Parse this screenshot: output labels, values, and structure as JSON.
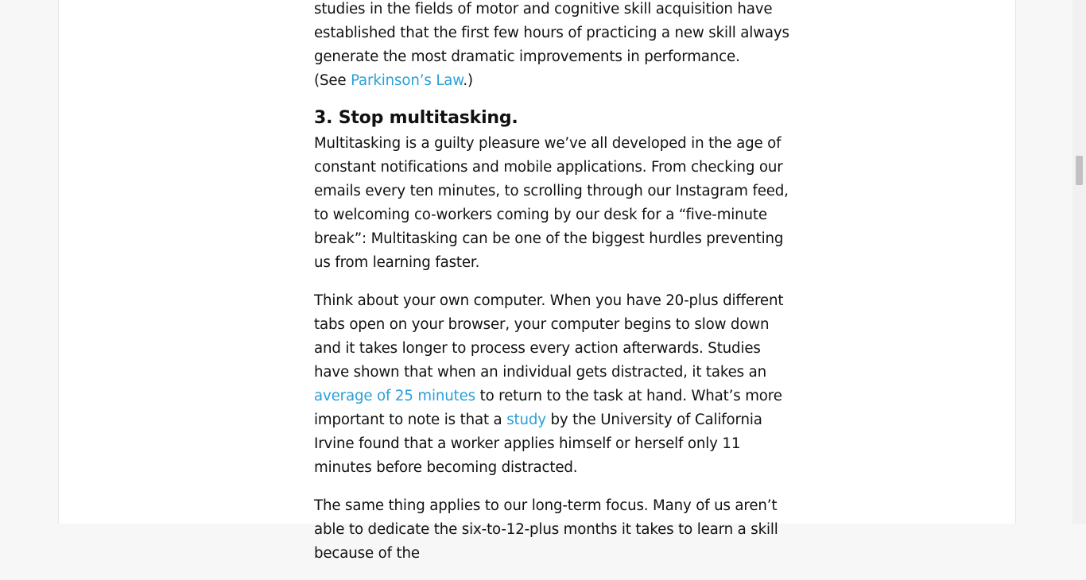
{
  "article": {
    "intro": {
      "text": "studies in the fields of motor and cognitive skill acquisition have established that the first few hours of practicing a new skill always generate the most dramatic improvements in performance.",
      "see_prefix": "(See ",
      "see_link": "Parkinson’s Law",
      "see_suffix": ".)"
    },
    "section_heading": "3. Stop multitasking.",
    "para1": "Multitasking is a guilty pleasure we’ve all developed in the age of constant notifications and mobile applications. From checking our emails every ten minutes, to scrolling through our Instagram feed, to welcoming co-workers coming by our desk for a “five-minute break”: Multitasking can be one of the biggest hurdles preventing us from learning faster.",
    "para2": {
      "part1": "Think about your own computer. When you have 20-plus different tabs open on your browser, your computer begins to slow down and it takes longer to process every action afterwards. Studies have shown that when an individual gets distracted, it takes an ",
      "link1": "average of 25 minutes",
      "part2": " to return to the task at hand. What’s more important to note is that a ",
      "link2": "study",
      "part3": " by the University of California Irvine found that a worker applies himself or herself only 11 minutes before becoming distracted."
    },
    "para3": "The same thing applies to our long-term focus. Many of us aren’t able to dedicate the six-to-12-plus months it takes to learn a skill because of the"
  },
  "colors": {
    "link": "#2a9fd8",
    "text": "#111111",
    "background": "#f7f7f7",
    "content_background": "#ffffff"
  }
}
